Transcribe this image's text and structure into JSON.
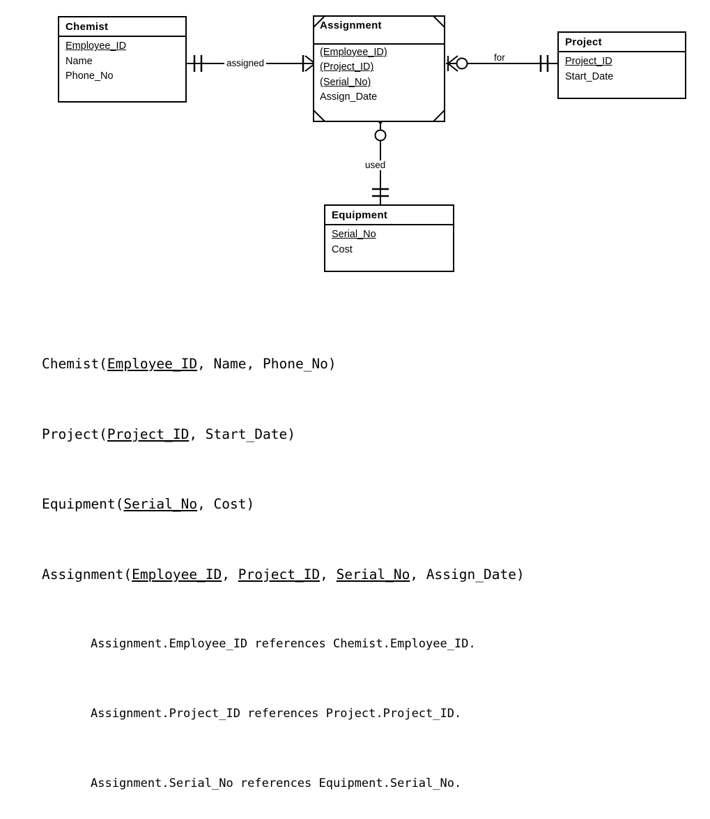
{
  "diagram": {
    "type": "entity-relationship-diagram",
    "notation": "crow's foot",
    "entities": [
      {
        "id": "chemist",
        "name": "Chemist",
        "kind": "strong-entity",
        "attributes": [
          {
            "label": "Employee_ID",
            "key": true
          },
          {
            "label": "Name",
            "key": false
          },
          {
            "label": "Phone_No",
            "key": false
          }
        ]
      },
      {
        "id": "assignment",
        "name": "Assignment",
        "kind": "associative-entity",
        "attributes": [
          {
            "label": "(Employee_ID)",
            "key": true
          },
          {
            "label": "(Project_ID)",
            "key": true
          },
          {
            "label": "(Serial_No)",
            "key": true
          },
          {
            "label": "Assign_Date",
            "key": false
          }
        ]
      },
      {
        "id": "project",
        "name": "Project",
        "kind": "strong-entity",
        "attributes": [
          {
            "label": "Project_ID",
            "key": true
          },
          {
            "label": "Start_Date",
            "key": false
          }
        ]
      },
      {
        "id": "equipment",
        "name": "Equipment",
        "kind": "strong-entity",
        "attributes": [
          {
            "label": "Serial_No",
            "key": true
          },
          {
            "label": "Cost",
            "key": false
          }
        ]
      }
    ],
    "relationships": [
      {
        "id": "assigned",
        "label": "assigned",
        "from": "chemist",
        "from_cardinality": "exactly-one",
        "to": "assignment",
        "to_cardinality": "one-or-many"
      },
      {
        "id": "for",
        "label": "for",
        "from": "assignment",
        "from_cardinality": "zero-or-many",
        "to": "project",
        "to_cardinality": "exactly-one"
      },
      {
        "id": "used",
        "label": "used",
        "from": "assignment",
        "from_cardinality": "zero-or-many",
        "to": "equipment",
        "to_cardinality": "exactly-one"
      }
    ]
  },
  "schema": {
    "relations": [
      {
        "id": "chemist-relation",
        "parts": [
          {
            "text": "Chemist(",
            "underline": false
          },
          {
            "text": "Employee_ID",
            "underline": true
          },
          {
            "text": ", Name, Phone_No)",
            "underline": false
          }
        ]
      },
      {
        "id": "project-relation",
        "parts": [
          {
            "text": "Project(",
            "underline": false
          },
          {
            "text": "Project_ID",
            "underline": true
          },
          {
            "text": ", Start_Date)",
            "underline": false
          }
        ]
      },
      {
        "id": "equipment-relation",
        "parts": [
          {
            "text": "Equipment(",
            "underline": false
          },
          {
            "text": "Serial_No",
            "underline": true
          },
          {
            "text": ", Cost)",
            "underline": false
          }
        ]
      },
      {
        "id": "assignment-relation",
        "parts": [
          {
            "text": "Assignment(",
            "underline": false
          },
          {
            "text": "Employee_ID",
            "underline": true
          },
          {
            "text": ", ",
            "underline": false
          },
          {
            "text": "Project_ID",
            "underline": true
          },
          {
            "text": ", ",
            "underline": false
          },
          {
            "text": "Serial_No",
            "underline": true
          },
          {
            "text": ", Assign_Date)",
            "underline": false
          }
        ]
      }
    ],
    "references": [
      "Assignment.Employee_ID references Chemist.Employee_ID.",
      "Assignment.Project_ID references Project.Project_ID.",
      "Assignment.Serial_No references Equipment.Serial_No."
    ]
  },
  "colors": {
    "ink": "#000000",
    "paper": "#ffffff"
  }
}
